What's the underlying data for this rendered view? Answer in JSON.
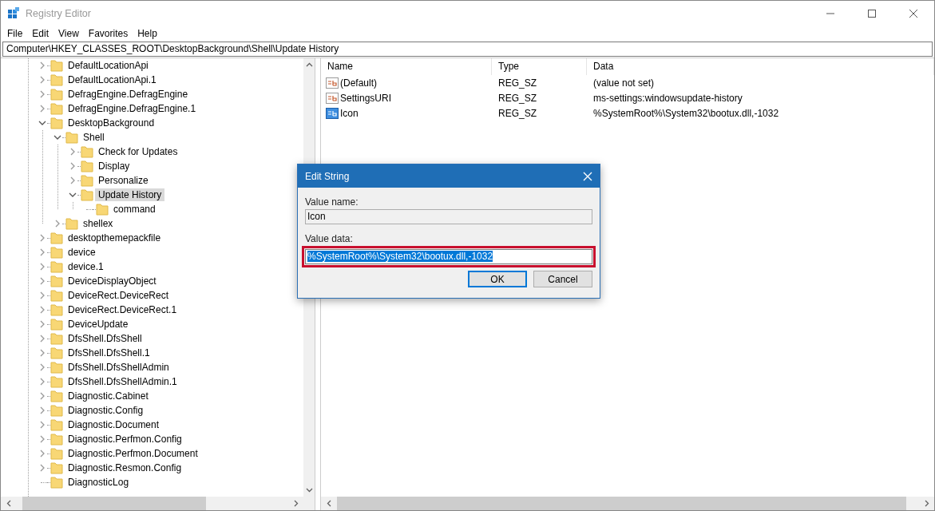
{
  "window": {
    "title": "Registry Editor"
  },
  "menu": [
    "File",
    "Edit",
    "View",
    "Favorites",
    "Help"
  ],
  "address": "Computer\\HKEY_CLASSES_ROOT\\DesktopBackground\\Shell\\Update History",
  "tree": {
    "items": [
      {
        "label": "DefaultLocationApi",
        "expanded": false,
        "selected": false
      },
      {
        "label": "DefaultLocationApi.1",
        "expanded": false,
        "selected": false
      },
      {
        "label": "DefragEngine.DefragEngine",
        "expanded": false,
        "selected": false
      },
      {
        "label": "DefragEngine.DefragEngine.1",
        "expanded": false,
        "selected": false
      },
      {
        "label": "DesktopBackground",
        "expanded": true,
        "selected": false,
        "children": [
          {
            "label": "Shell",
            "expanded": true,
            "selected": false,
            "children": [
              {
                "label": "Check for Updates",
                "expanded": false,
                "selected": false
              },
              {
                "label": "Display",
                "expanded": false,
                "selected": false
              },
              {
                "label": "Personalize",
                "expanded": false,
                "selected": false
              },
              {
                "label": "Update History",
                "expanded": true,
                "selected": true,
                "children": [
                  {
                    "label": "command",
                    "selected": false
                  }
                ]
              }
            ]
          },
          {
            "label": "shellex",
            "expanded": false,
            "selected": false
          }
        ]
      },
      {
        "label": "desktopthemepackfile",
        "expanded": false,
        "selected": false
      },
      {
        "label": "device",
        "expanded": false,
        "selected": false
      },
      {
        "label": "device.1",
        "expanded": false,
        "selected": false
      },
      {
        "label": "DeviceDisplayObject",
        "expanded": false,
        "selected": false
      },
      {
        "label": "DeviceRect.DeviceRect",
        "expanded": false,
        "selected": false
      },
      {
        "label": "DeviceRect.DeviceRect.1",
        "expanded": false,
        "selected": false
      },
      {
        "label": "DeviceUpdate",
        "expanded": false,
        "selected": false
      },
      {
        "label": "DfsShell.DfsShell",
        "expanded": false,
        "selected": false
      },
      {
        "label": "DfsShell.DfsShell.1",
        "expanded": false,
        "selected": false
      },
      {
        "label": "DfsShell.DfsShellAdmin",
        "expanded": false,
        "selected": false
      },
      {
        "label": "DfsShell.DfsShellAdmin.1",
        "expanded": false,
        "selected": false
      },
      {
        "label": "Diagnostic.Cabinet",
        "expanded": false,
        "selected": false
      },
      {
        "label": "Diagnostic.Config",
        "expanded": false,
        "selected": false
      },
      {
        "label": "Diagnostic.Document",
        "expanded": false,
        "selected": false
      },
      {
        "label": "Diagnostic.Perfmon.Config",
        "expanded": false,
        "selected": false
      },
      {
        "label": "Diagnostic.Perfmon.Document",
        "expanded": false,
        "selected": false
      },
      {
        "label": "Diagnostic.Resmon.Config",
        "expanded": false,
        "selected": false
      },
      {
        "label": "DiagnosticLog",
        "selected": false
      }
    ]
  },
  "values": {
    "columns": [
      "Name",
      "Type",
      "Data"
    ],
    "rows": [
      {
        "name": "(Default)",
        "type": "REG_SZ",
        "data": "(value not set)",
        "selected": false
      },
      {
        "name": "SettingsURI",
        "type": "REG_SZ",
        "data": "ms-settings:windowsupdate-history",
        "selected": false
      },
      {
        "name": "Icon",
        "type": "REG_SZ",
        "data": "%SystemRoot%\\System32\\bootux.dll,-1032",
        "selected": true
      }
    ]
  },
  "dialog": {
    "title": "Edit String",
    "name_label": "Value name:",
    "name_value": "Icon",
    "data_label": "Value data:",
    "data_value": "%SystemRoot%\\System32\\bootux.dll,-1032",
    "data_selected": true,
    "buttons": [
      {
        "label": "OK",
        "default": true
      },
      {
        "label": "Cancel",
        "default": false
      }
    ]
  }
}
